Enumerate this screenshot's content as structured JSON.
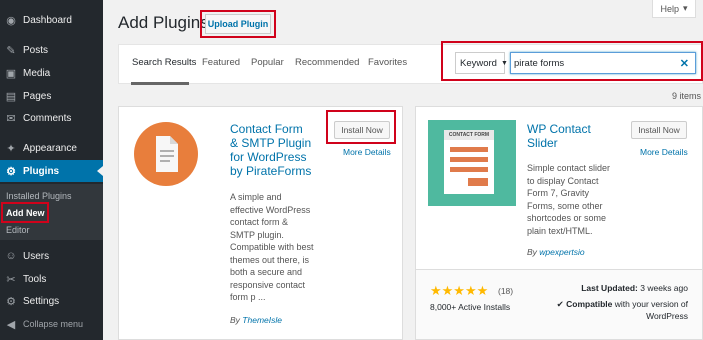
{
  "sidebar": {
    "items": [
      {
        "label": "Dashboard",
        "icon": "dashboard-icon",
        "glyph": "◉"
      },
      {
        "label": "Posts",
        "icon": "pin-icon",
        "glyph": "✎"
      },
      {
        "label": "Media",
        "icon": "media-icon",
        "glyph": "▣"
      },
      {
        "label": "Pages",
        "icon": "pages-icon",
        "glyph": "▤"
      },
      {
        "label": "Comments",
        "icon": "comments-icon",
        "glyph": "✉"
      },
      {
        "label": "Appearance",
        "icon": "appearance-icon",
        "glyph": "✦"
      },
      {
        "label": "Plugins",
        "icon": "plugins-icon",
        "glyph": "⚙"
      },
      {
        "label": "Users",
        "icon": "users-icon",
        "glyph": "☺"
      },
      {
        "label": "Tools",
        "icon": "tools-icon",
        "glyph": "✂"
      },
      {
        "label": "Settings",
        "icon": "settings-icon",
        "glyph": "⚙"
      },
      {
        "label": "Collapse menu",
        "icon": "collapse-icon",
        "glyph": "◀"
      }
    ],
    "submenu": [
      "Installed Plugins",
      "Add New",
      "Editor"
    ]
  },
  "header": {
    "title": "Add Plugins",
    "upload_label": "Upload Plugin",
    "help_label": "Help",
    "help_caret": "▾"
  },
  "filter": {
    "tabs": [
      "Search Results",
      "Featured",
      "Popular",
      "Recommended",
      "Favorites"
    ],
    "select_value": "Keyword",
    "select_caret": "▼",
    "search_value": "pirate forms",
    "clear_glyph": "✕"
  },
  "items_count": "9 items",
  "plugins": [
    {
      "title": "Contact Form & SMTP Plugin for WordPress by PirateForms",
      "title_lines": [
        "Contact Form",
        "& SMTP Plugin",
        "for WordPress",
        "by PirateForms"
      ],
      "install_label": "Install Now",
      "details_label": "More Details",
      "description_lines": [
        "A simple and",
        "effective WordPress",
        "contact form &",
        "SMTP plugin.",
        "Compatible with best",
        "themes out there, is",
        "both a secure and",
        "responsive contact",
        "form p ..."
      ],
      "author_prefix": "By",
      "author": "ThemeIsle"
    },
    {
      "title": "WP Contact Slider",
      "title_lines": [
        "WP Contact",
        "Slider"
      ],
      "icon_label": "CONTACT FORM",
      "install_label": "Install Now",
      "details_label": "More Details",
      "description_lines": [
        "Simple contact slider",
        "to display Contact",
        "Form 7, Gravity",
        "Forms, some other",
        "shortcodes or some",
        "plain text/HTML."
      ],
      "author_prefix": "By",
      "author": "wpexpertsio",
      "stars": "★★★★★",
      "rating_count": "(18)",
      "installs": "8,000+ Active Installs",
      "last_updated_label": "Last Updated:",
      "last_updated_value": "3 weeks ago",
      "compat_check": "✔",
      "compat_bold": "Compatible",
      "compat_rest_1": "with your version of",
      "compat_rest_2": "WordPress"
    }
  ],
  "colors": {
    "sidebar_bg": "#23282d",
    "active_bg": "#0073aa",
    "link": "#0073aa",
    "highlight_box": "#d0021b",
    "star": "#ffb900",
    "cf_icon": "#e87e3c",
    "slider_icon": "#4fb99f"
  }
}
